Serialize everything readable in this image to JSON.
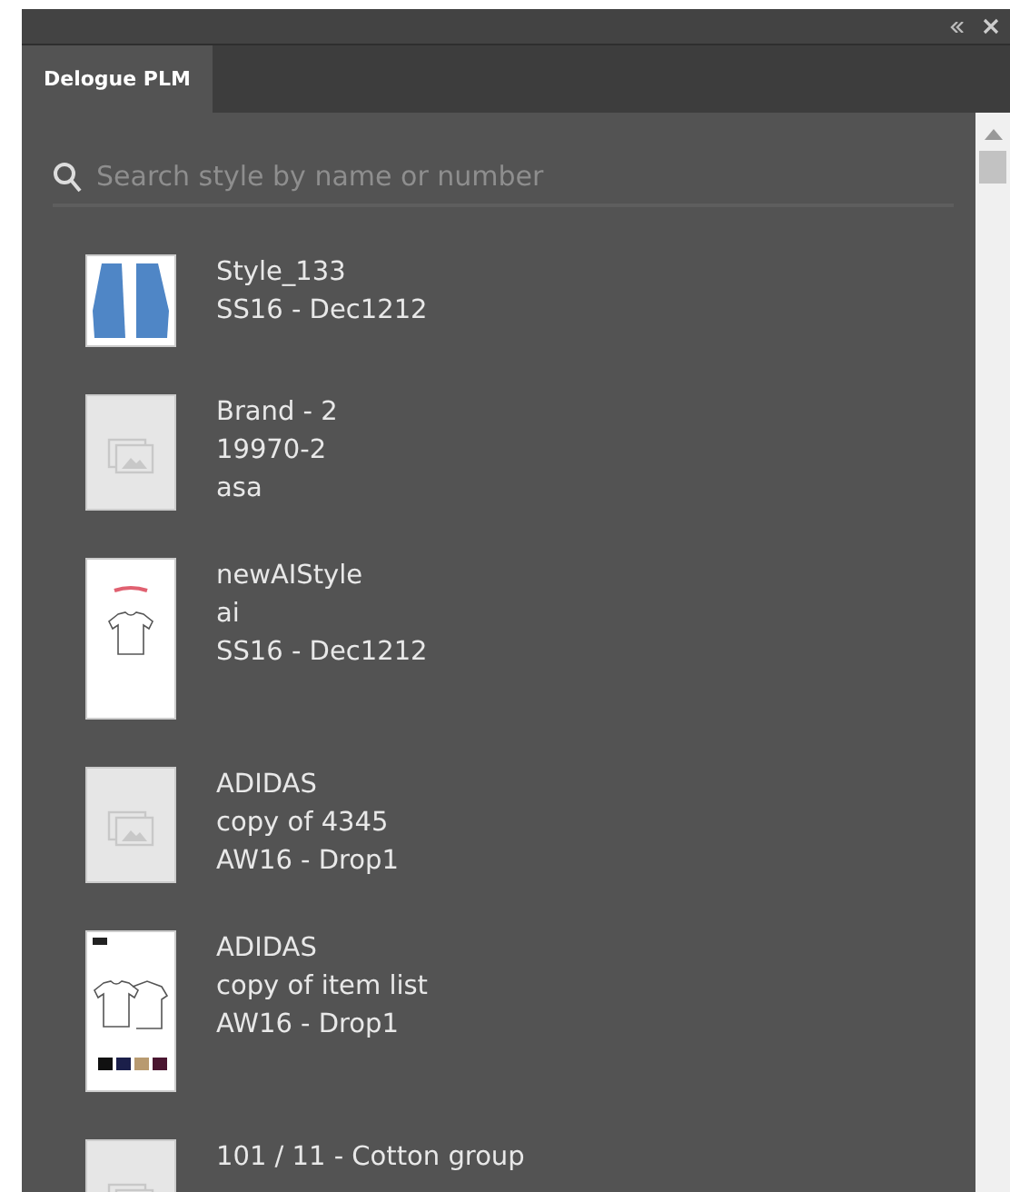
{
  "panel": {
    "tab": {
      "label": "Delogue PLM",
      "selected": true
    }
  },
  "search": {
    "placeholder": "Search style by name or number"
  },
  "styles": [
    {
      "kind": "photo",
      "lines": [
        "Style_133",
        "SS16 - Dec1212"
      ]
    },
    {
      "kind": "placeholder",
      "lines": [
        "Brand - 2",
        "19970-2",
        "asa"
      ]
    },
    {
      "kind": "sketch",
      "lines": [
        "newAIStyle",
        "ai",
        "SS16 - Dec1212"
      ]
    },
    {
      "kind": "placeholder",
      "lines": [
        "ADIDAS",
        "copy of 4345",
        "AW16 - Drop1"
      ]
    },
    {
      "kind": "sheet",
      "lines": [
        "ADIDAS",
        "copy of item list",
        "AW16 - Drop1"
      ]
    },
    {
      "kind": "placeholder",
      "lines": [
        "101 / 11 - Cotton group"
      ]
    }
  ]
}
